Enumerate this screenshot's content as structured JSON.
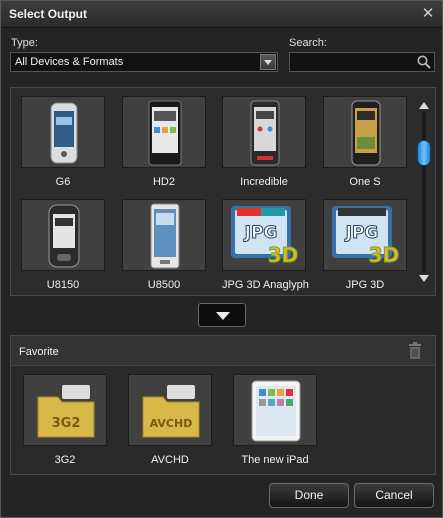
{
  "window": {
    "title": "Select Output"
  },
  "type": {
    "label": "Type:",
    "selected": "All Devices & Formats"
  },
  "search": {
    "label": "Search:",
    "value": "",
    "placeholder": ""
  },
  "devices": [
    {
      "label": "G6",
      "icon": "phone-g6-icon"
    },
    {
      "label": "HD2",
      "icon": "phone-hd2-icon"
    },
    {
      "label": "Incredible",
      "icon": "phone-incredible-icon"
    },
    {
      "label": "One S",
      "icon": "phone-one-s-icon"
    },
    {
      "label": "U8150",
      "icon": "phone-u8150-icon"
    },
    {
      "label": "U8500",
      "icon": "phone-u8500-icon"
    },
    {
      "label": "JPG 3D Anaglyph",
      "icon": "jpg-3d-anaglyph-icon",
      "badge": "JPG",
      "badge2": "3D"
    },
    {
      "label": "JPG 3D",
      "icon": "jpg-3d-icon",
      "badge": "JPG",
      "badge2": "3D"
    }
  ],
  "favorite": {
    "title": "Favorite",
    "items": [
      {
        "label": "3G2",
        "icon": "folder-3g2-icon",
        "tag": "3G2"
      },
      {
        "label": "AVCHD",
        "icon": "folder-avchd-icon",
        "tag": "AVCHD"
      },
      {
        "label": "The new iPad",
        "icon": "ipad-icon"
      }
    ]
  },
  "buttons": {
    "done": "Done",
    "cancel": "Cancel"
  },
  "colors": {
    "accent": "#3a9bf0",
    "background": "#242424",
    "tile": "#404040"
  }
}
